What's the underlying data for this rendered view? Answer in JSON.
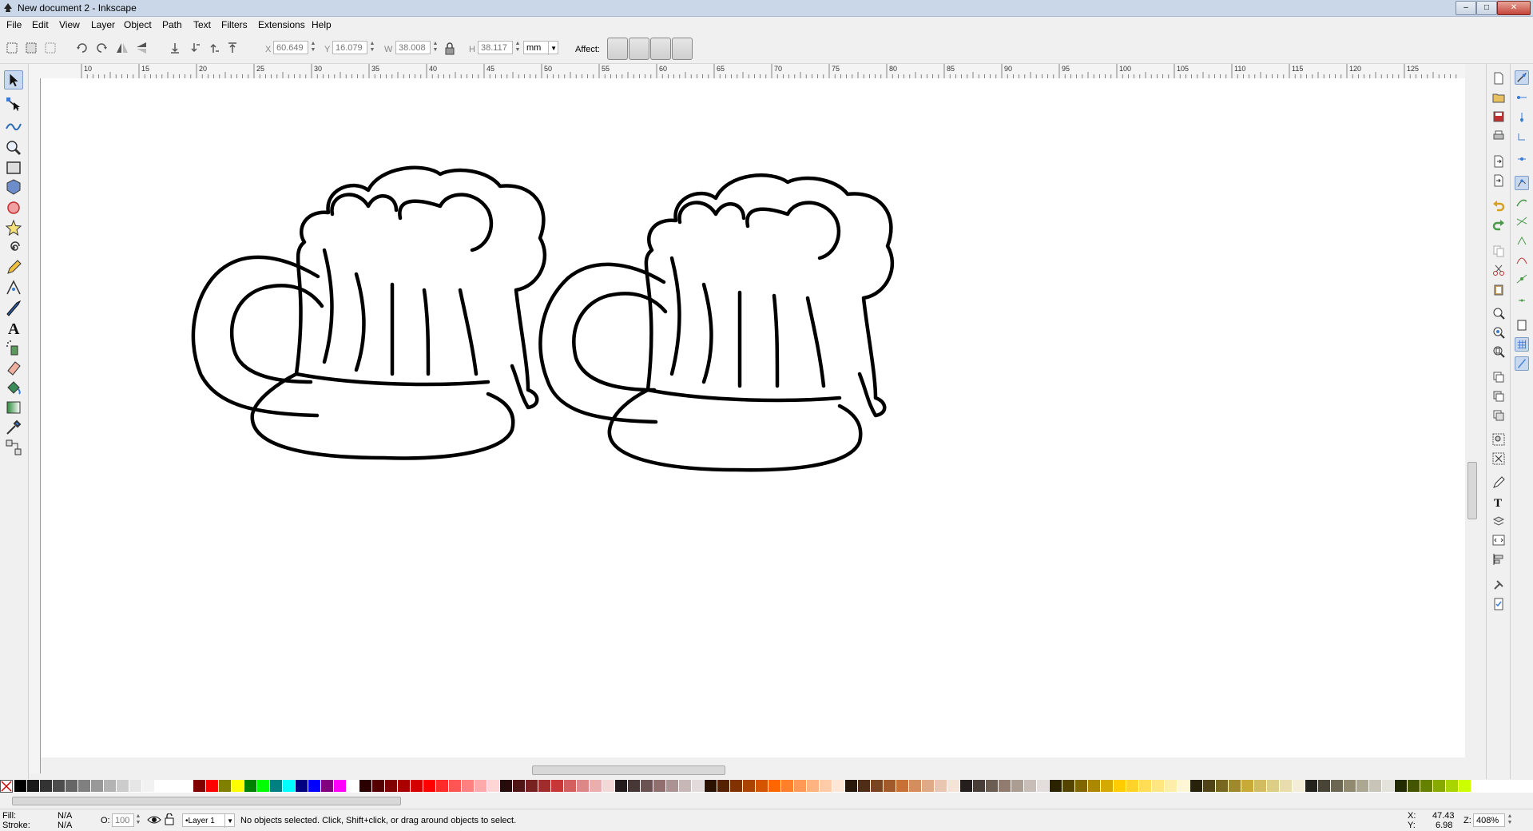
{
  "window": {
    "title": "New document 2 - Inkscape",
    "minimize": "–",
    "maximize": "□",
    "close": "✕"
  },
  "menubar": [
    "File",
    "Edit",
    "View",
    "Layer",
    "Object",
    "Path",
    "Text",
    "Filters",
    "Extensions",
    "Help"
  ],
  "toolbar": {
    "x_label": "X",
    "x_value": "60.649",
    "y_label": "Y",
    "y_value": "16.079",
    "w_label": "W",
    "w_value": "38.008",
    "h_label": "H",
    "h_value": "38.117",
    "unit": "mm",
    "affect_label": "Affect:"
  },
  "ruler": {
    "ticks": [
      "10",
      "15",
      "20",
      "25",
      "30",
      "35",
      "40",
      "45",
      "50",
      "55",
      "60",
      "65",
      "70",
      "75",
      "80",
      "85",
      "90",
      "95",
      "100",
      "105",
      "110",
      "115",
      "120",
      "125"
    ]
  },
  "status": {
    "fill_label": "Fill:",
    "fill_value": "N/A",
    "stroke_label": "Stroke:",
    "stroke_value": "N/A",
    "opacity_label": "O:",
    "opacity_value": "100",
    "layer": "•Layer 1",
    "message": "No objects selected. Click, Shift+click, or drag around objects to select.",
    "x_label": "X:",
    "x_value": "47.43",
    "y_label": "Y:",
    "y_value": "6.98",
    "zoom_label": "Z:",
    "zoom_value": "408%"
  },
  "palette_colors": [
    "#000000",
    "#1a1a1a",
    "#333333",
    "#4d4d4d",
    "#666666",
    "#808080",
    "#999999",
    "#b3b3b3",
    "#cccccc",
    "#e6e6e6",
    "#f2f2f2",
    "#ffffff",
    "#ffffff",
    "#ffffff",
    "#800000",
    "#ff0000",
    "#808000",
    "#ffff00",
    "#008000",
    "#00ff00",
    "#008080",
    "#00ffff",
    "#000080",
    "#0000ff",
    "#800080",
    "#ff00ff",
    "#ffffff",
    "#2b0000",
    "#550000",
    "#800000",
    "#aa0000",
    "#d40000",
    "#ff0000",
    "#ff2a2a",
    "#ff5555",
    "#ff8080",
    "#ffaaaa",
    "#ffd5d5",
    "#280b0b",
    "#501616",
    "#782121",
    "#a02c2c",
    "#c83737",
    "#d35f5f",
    "#de8787",
    "#e9afaf",
    "#f4d7d7",
    "#241c1c",
    "#483737",
    "#6c5353",
    "#916f6f",
    "#ac9393",
    "#c8b7b7",
    "#e3dbdb",
    "#2b1100",
    "#552200",
    "#803300",
    "#aa4400",
    "#d45500",
    "#ff6600",
    "#ff7f2a",
    "#ff9955",
    "#ffb380",
    "#ffccaa",
    "#ffe6d5",
    "#28170b",
    "#502d16",
    "#784421",
    "#a05a2c",
    "#c87137",
    "#d38d5f",
    "#deaa87",
    "#e9c6af",
    "#f4e3d7",
    "#241f1c",
    "#483e37",
    "#6c5d53",
    "#917c6f",
    "#ac9d93",
    "#c8beb7",
    "#e3dedb",
    "#2b2200",
    "#554400",
    "#806600",
    "#aa8800",
    "#d4aa00",
    "#ffcc00",
    "#ffd42a",
    "#ffdd55",
    "#ffe680",
    "#ffeeaa",
    "#fff6d5",
    "#28220b",
    "#504416",
    "#786721",
    "#a0892c",
    "#c8ab37",
    "#d3bc5f",
    "#decd87",
    "#e9ddaf",
    "#f4eed7",
    "#24221c",
    "#484537",
    "#6c6753",
    "#918a6f",
    "#aca793",
    "#c8c4b7",
    "#e3e2db",
    "#222b00",
    "#445500",
    "#668000",
    "#88aa00",
    "#aad400",
    "#ccff00"
  ]
}
